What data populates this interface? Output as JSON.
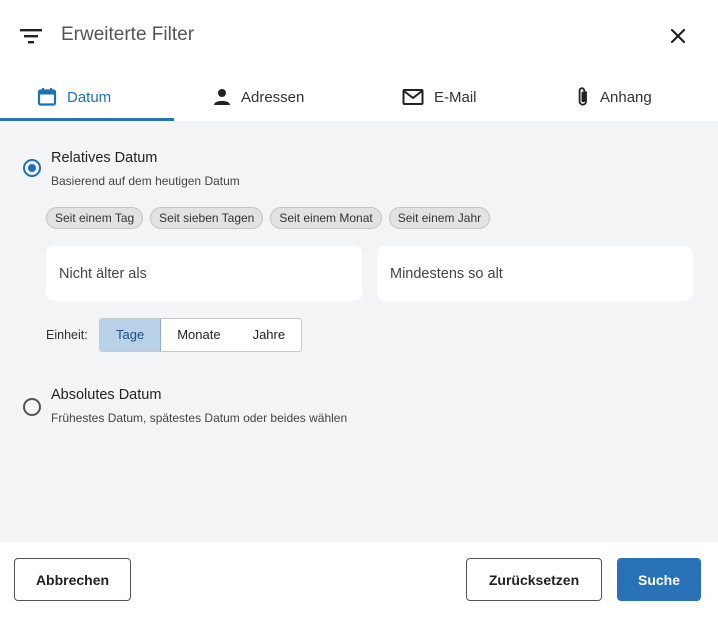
{
  "header": {
    "title": "Erweiterte Filter"
  },
  "tabs": [
    {
      "label": "Datum",
      "icon": "calendar-icon",
      "active": true
    },
    {
      "label": "Adressen",
      "icon": "person-icon",
      "active": false
    },
    {
      "label": "E-Mail",
      "icon": "envelope-icon",
      "active": false
    },
    {
      "label": "Anhang",
      "icon": "paperclip-icon",
      "active": false
    }
  ],
  "relative": {
    "title": "Relatives Datum",
    "subtitle": "Basierend auf dem heutigen Datum",
    "selected": true,
    "chips": [
      "Seit einem Tag",
      "Seit sieben Tagen",
      "Seit einem Monat",
      "Seit einem Jahr"
    ],
    "not_older_placeholder": "Nicht älter als",
    "min_age_placeholder": "Mindestens so alt",
    "unit_label": "Einheit:",
    "units": [
      "Tage",
      "Monate",
      "Jahre"
    ],
    "selected_unit": "Tage"
  },
  "absolute": {
    "title": "Absolutes Datum",
    "subtitle": "Frühestes Datum, spätestes Datum oder beides wählen",
    "selected": false
  },
  "footer": {
    "cancel_label": "Abbrechen",
    "reset_label": "Zurücksetzen",
    "search_label": "Suche"
  },
  "colors": {
    "accent": "#2a72b8",
    "segment_active_bg": "#b9d0e9",
    "background": "#f3f4f6"
  }
}
